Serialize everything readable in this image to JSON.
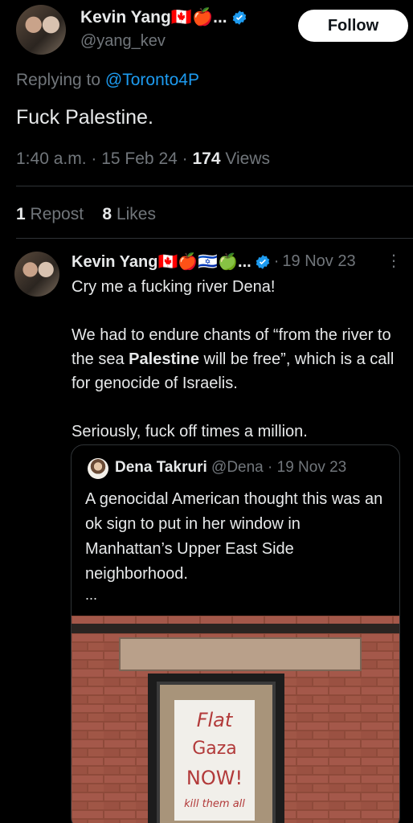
{
  "tweet": {
    "author_name": "Kevin Yang🇨🇦🍎...",
    "handle": "@yang_kev",
    "follow_label": "Follow",
    "replying_prefix": "Replying to",
    "replying_to": "@Toronto4P",
    "text": "Fuck Palestine.",
    "time": "1:40 a.m.",
    "date": "15 Feb 24",
    "views_count": "174",
    "views_label": "Views",
    "reposts_count": "1",
    "reposts_label": "Repost",
    "likes_count": "8",
    "likes_label": "Likes"
  },
  "reply": {
    "author_name": "Kevin Yang🇨🇦🍎🇮🇱🍏...",
    "date": "19 Nov 23",
    "more_icon": "more-vertical-icon",
    "line1": "Cry me a fucking river Dena!",
    "para2_before": "We had to endure chants of “from the river to the sea ",
    "para2_bold": "Palestine",
    "para2_after": " will be free”, which is a call for genocide of Israelis.",
    "para3": "Seriously, fuck off times a million."
  },
  "quote": {
    "author_name": "Dena Takruri",
    "handle": "@Dena",
    "date": "19 Nov 23",
    "text": "A genocidal American thought this was an ok sign to put in her window in Manhattan’s Upper East Side neighborhood.",
    "ellipsis": "...",
    "sign_lines": [
      "Flat",
      "Gaza",
      "NOW!",
      "kill them all"
    ]
  },
  "colors": {
    "background": "#000000",
    "text": "#e7e9ea",
    "muted": "#71767b",
    "link": "#1d9bf0",
    "border": "#2f3336"
  }
}
